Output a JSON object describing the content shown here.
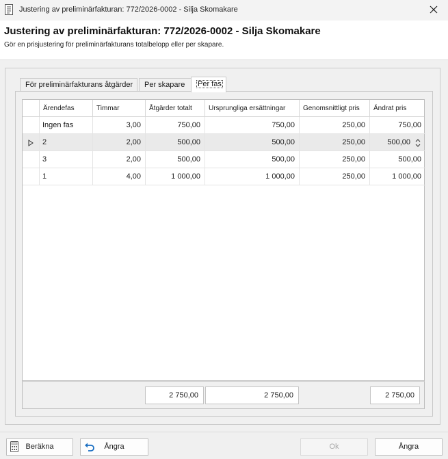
{
  "window": {
    "title": "Justering av preliminärfakturan: 772/2026-0002 - Silja Skomakare",
    "close_icon": "close-icon",
    "app_icon": "document-icon"
  },
  "header": {
    "heading": "Justering av preliminärfakturan: 772/2026-0002 - Silja Skomakare",
    "subheading": "Gör en prisjustering för preliminärfakturans totalbelopp eller per skapare."
  },
  "tabs": [
    {
      "label": "För preliminärfakturans åtgärder",
      "active": false
    },
    {
      "label": "Per skapare",
      "active": false
    },
    {
      "label": "Per fas",
      "active": true
    }
  ],
  "grid": {
    "columns": [
      "Ärendefas",
      "Timmar",
      "Åtgärder totalt",
      "Ursprungliga ersättningar",
      "Genomsnittligt pris",
      "Ändrat pris"
    ],
    "rows": [
      {
        "fas": "Ingen fas",
        "timmar": "3,00",
        "atgarder": "750,00",
        "ursprungliga": "750,00",
        "genomsnitt": "250,00",
        "andrat": "750,00",
        "selected": false
      },
      {
        "fas": "2",
        "timmar": "2,00",
        "atgarder": "500,00",
        "ursprungliga": "500,00",
        "genomsnitt": "250,00",
        "andrat": "500,00",
        "selected": true
      },
      {
        "fas": "3",
        "timmar": "2,00",
        "atgarder": "500,00",
        "ursprungliga": "500,00",
        "genomsnitt": "250,00",
        "andrat": "500,00",
        "selected": false
      },
      {
        "fas": "1",
        "timmar": "4,00",
        "atgarder": "1 000,00",
        "ursprungliga": "1 000,00",
        "genomsnitt": "250,00",
        "andrat": "1 000,00",
        "selected": false
      }
    ],
    "totals": {
      "atgarder": "2 750,00",
      "ursprungliga": "2 750,00",
      "andrat": "2 750,00"
    }
  },
  "buttons": {
    "berakna": "Beräkna",
    "angra_undo": "Ångra",
    "ok": "Ok",
    "angra_cancel": "Ångra"
  },
  "colors": {
    "selected_row": "#eaeaea",
    "undo_icon": "#1a6fc2"
  }
}
